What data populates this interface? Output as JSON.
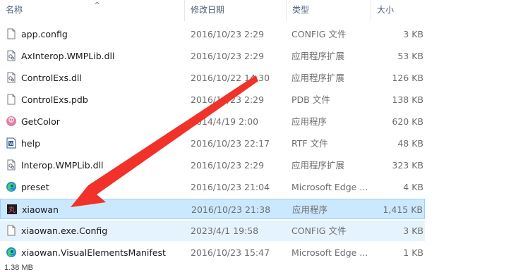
{
  "columns": {
    "name": "名称",
    "date": "修改日期",
    "type": "类型",
    "size": "大小"
  },
  "files": [
    {
      "name": "app.config",
      "date": "2016/10/23 2:29",
      "type": "CONFIG 文件",
      "size": "3 KB",
      "icon": "config-file-icon"
    },
    {
      "name": "AxInterop.WMPLib.dll",
      "date": "2016/10/23 2:29",
      "type": "应用程序扩展",
      "size": "53 KB",
      "icon": "dll-file-icon"
    },
    {
      "name": "ControlExs.dll",
      "date": "2016/10/22 14:30",
      "type": "应用程序扩展",
      "size": "126 KB",
      "icon": "dll-file-icon"
    },
    {
      "name": "ControlExs.pdb",
      "date": "2016/10/23 2:29",
      "type": "PDB 文件",
      "size": "138 KB",
      "icon": "pdb-file-icon"
    },
    {
      "name": "GetColor",
      "date": "2014/4/19 2:00",
      "type": "应用程序",
      "size": "620 KB",
      "icon": "getcolor-app-icon"
    },
    {
      "name": "help",
      "date": "2016/10/23 22:17",
      "type": "RTF 文件",
      "size": "48 KB",
      "icon": "rtf-file-icon"
    },
    {
      "name": "Interop.WMPLib.dll",
      "date": "2016/10/23 2:29",
      "type": "应用程序扩展",
      "size": "323 KB",
      "icon": "dll-file-icon"
    },
    {
      "name": "preset",
      "date": "2016/10/23 21:04",
      "type": "Microsoft Edge ...",
      "size": "4 KB",
      "icon": "edge-icon"
    },
    {
      "name": "xiaowan",
      "date": "2016/10/23 21:38",
      "type": "应用程序",
      "size": "1,415 KB",
      "icon": "xiaowan-app-icon",
      "state": "selected"
    },
    {
      "name": "xiaowan.exe.Config",
      "date": "2023/4/1 19:58",
      "type": "CONFIG 文件",
      "size": "3 KB",
      "icon": "config-file-icon",
      "state": "hover"
    },
    {
      "name": "xiaowan.VisualElementsManifest",
      "date": "2016/10/23 15:47",
      "type": "Microsoft Edge ...",
      "size": "1 KB",
      "icon": "edge-icon"
    }
  ],
  "status_text": "1.38 MB",
  "colors": {
    "selected_bg": "#cce8ff",
    "hover_bg": "#e5f3ff",
    "arrow": "#f0322a"
  }
}
